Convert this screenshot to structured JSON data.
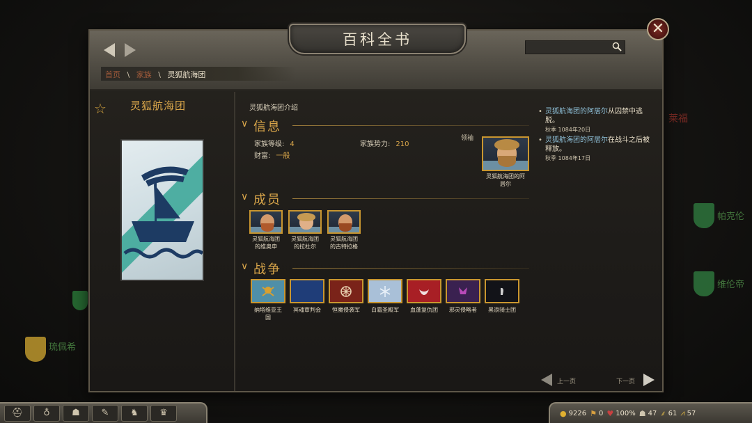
{
  "window": {
    "title": "百科全书",
    "close_glyph": "✕"
  },
  "breadcrumb": {
    "home": "首页",
    "sep1": "\\",
    "clans": "家族",
    "sep2": "\\",
    "current": "灵狐航海团"
  },
  "search": {
    "placeholder": ""
  },
  "clan": {
    "name": "灵狐航海团",
    "banner_bg": "#dfe8ec",
    "banner_stripe": "#3fa89a",
    "banner_ship": "#1d3b63"
  },
  "intro": {
    "title": "灵狐航海团介绍"
  },
  "sections": {
    "info": "信息",
    "members": "成员",
    "wars": "战争"
  },
  "info": {
    "tier_label": "家族等级:",
    "tier_value": "4",
    "strength_label": "家族势力:",
    "strength_value": "210",
    "wealth_label": "财富:",
    "wealth_value": "一般",
    "leader_label": "领袖",
    "leader_caption_1": "灵狐航海团的阿",
    "leader_caption_2": "居尔"
  },
  "members": [
    {
      "line1": "灵狐航海团",
      "line2": "的维奥申"
    },
    {
      "line1": "灵狐航海团",
      "line2": "的拉杜尔"
    },
    {
      "line1": "灵狐航海团",
      "line2": "的古特拉格"
    }
  ],
  "wars": [
    {
      "line1": "纳塔维亚王",
      "line2": "国",
      "color": "#4f8fa8"
    },
    {
      "line1": "冥魂审判会",
      "line2": "",
      "color": "#1f3d78"
    },
    {
      "line1": "恒魔侵袭军",
      "line2": "",
      "color": "#7a2319"
    },
    {
      "line1": "白霜圣殿军",
      "line2": "",
      "color": "#a9c0d8"
    },
    {
      "line1": "血蓬复仇团",
      "line2": "",
      "color": "#a81f25"
    },
    {
      "line1": "邪灵侵略者",
      "line2": "",
      "color": "#3a2150"
    },
    {
      "line1": "黑浪骑士团",
      "line2": "",
      "color": "#121318"
    }
  ],
  "log": [
    {
      "link": "灵狐航海团的阿居尔",
      "text": "从囚禁中逃脱。",
      "date": "秋季 1084年20日"
    },
    {
      "link": "灵狐航海团的阿居尔",
      "text": "在战斗之后被释放。",
      "date": "秋季 1084年17日"
    }
  ],
  "pager": {
    "prev": "上一页",
    "next": "下一页"
  },
  "map": {
    "label1": "琉佩希",
    "label2": "帕克伦",
    "label3": "维伦帝",
    "label4": "莱福"
  },
  "status_bar": {
    "gold": "9226",
    "influence": "0",
    "health": "100%",
    "troops": "47",
    "food": "61",
    "morale": "57"
  }
}
